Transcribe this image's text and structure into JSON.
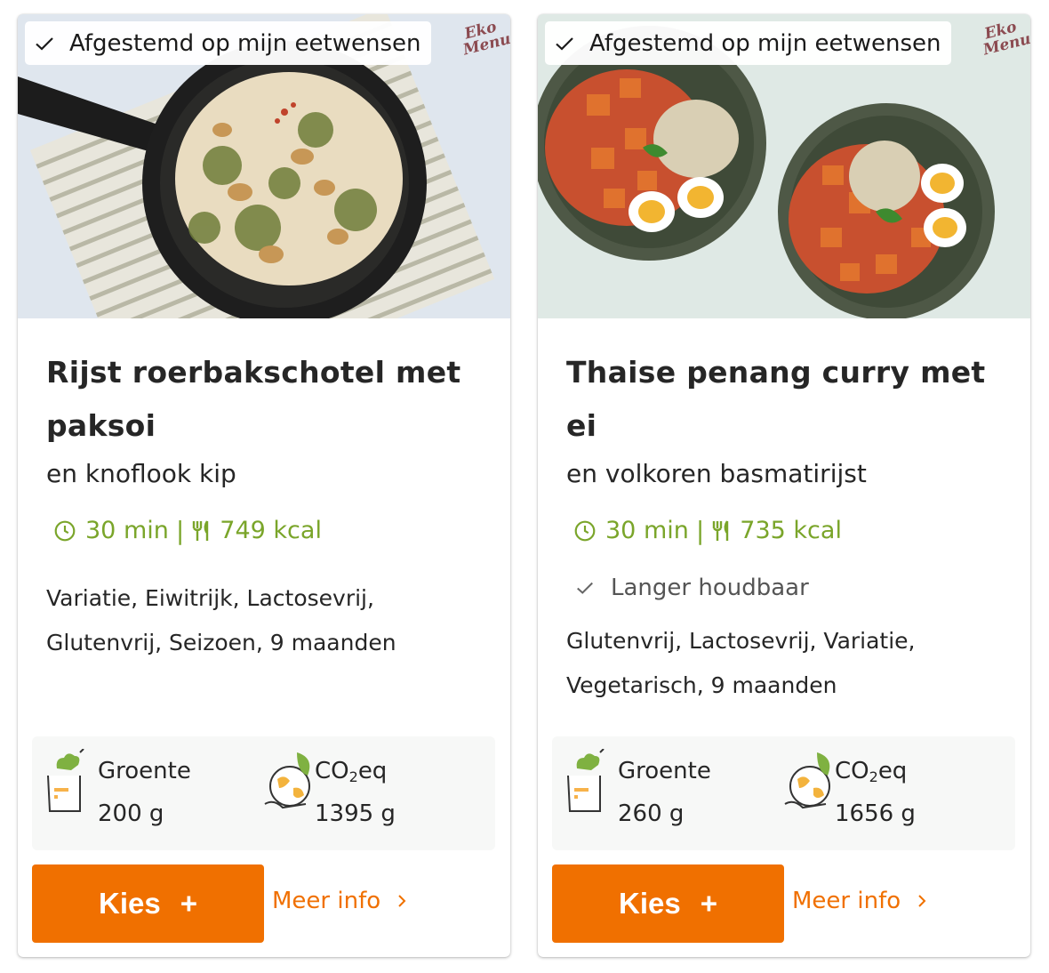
{
  "brand": {
    "logo_text": "Eko Menu",
    "accent_color": "#f07000",
    "meta_color": "#7aa52a"
  },
  "cards": [
    {
      "preference_badge": "Afgestemd op mijn eetwensen",
      "title": "Rijst roerbakschotel met paksoi",
      "subtitle": "en knoflook kip",
      "time": "30 min",
      "separator": "|",
      "calories": "749 kcal",
      "tags_line1": "Variatie, Eiwitrijk, Lactosevrij,",
      "tags_line2": "Glutenvrij, Seizoen, 9 maanden",
      "vegetables_label": "Groente",
      "vegetables_value": "200 g",
      "co2_label_prefix": "CO",
      "co2_label_sub": "2",
      "co2_label_suffix": "eq",
      "co2_value": "1395 g",
      "choose_label": "Kies",
      "choose_icon": "+",
      "more_info_label": "Meer info"
    },
    {
      "preference_badge": "Afgestemd op mijn eetwensen",
      "title": "Thaise penang curry met ei",
      "subtitle": "en volkoren basmatirijst",
      "time": "30 min",
      "separator": "|",
      "calories": "735 kcal",
      "keep_badge": "Langer houdbaar",
      "tags_line1": "Glutenvrij, Lactosevrij, Variatie,",
      "tags_line2": "Vegetarisch, 9 maanden",
      "vegetables_label": "Groente",
      "vegetables_value": "260 g",
      "co2_label_prefix": "CO",
      "co2_label_sub": "2",
      "co2_label_suffix": "eq",
      "co2_value": "1656 g",
      "choose_label": "Kies",
      "choose_icon": "+",
      "more_info_label": "Meer info"
    }
  ]
}
